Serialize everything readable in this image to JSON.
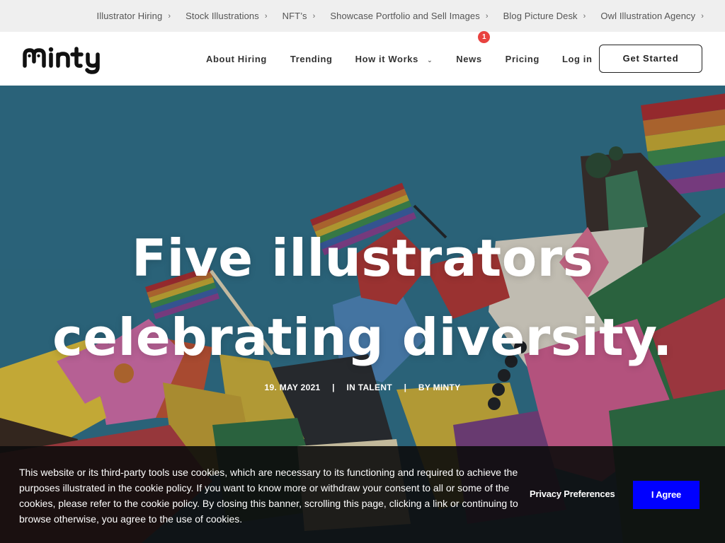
{
  "topbar": {
    "items": [
      {
        "label": "Illustrator Hiring"
      },
      {
        "label": "Stock Illustrations"
      },
      {
        "label": "NFT’s"
      },
      {
        "label": "Showcase Portfolio and Sell Images"
      },
      {
        "label": "Blog Picture Desk"
      },
      {
        "label": "Owl Illustration Agency"
      }
    ],
    "chevron": "›"
  },
  "nav": {
    "logo_text": "minty",
    "links": [
      {
        "label": "About Hiring"
      },
      {
        "label": "Trending"
      },
      {
        "label": "How it Works",
        "dropdown": "⌄"
      },
      {
        "label": "News",
        "badge": "1"
      },
      {
        "label": "Pricing"
      },
      {
        "label": "Log in"
      }
    ],
    "cta_label": "Get Started"
  },
  "hero": {
    "title_line1": "Five illustrators",
    "title_line2": "celebrating diversity.",
    "date": "19. MAY 2021",
    "category": "IN TALENT",
    "author": "BY MINTY",
    "separator": "|"
  },
  "cookie": {
    "text": "This website or its third-party tools use cookies, which are necessary to its functioning and required to achieve the purposes illustrated in the cookie policy. If you want to know more or withdraw your consent to all or some of the cookies, please refer to the cookie policy. By closing this banner, scrolling this page, clicking a link or continuing to browse otherwise, you agree to the use of cookies.",
    "preferences_label": "Privacy Preferences",
    "agree_label": "I Agree"
  },
  "colors": {
    "brand_black": "#111111",
    "badge_red": "#e8423f",
    "agree_blue": "#0000ff",
    "hero_blue": "#2f6f86"
  }
}
